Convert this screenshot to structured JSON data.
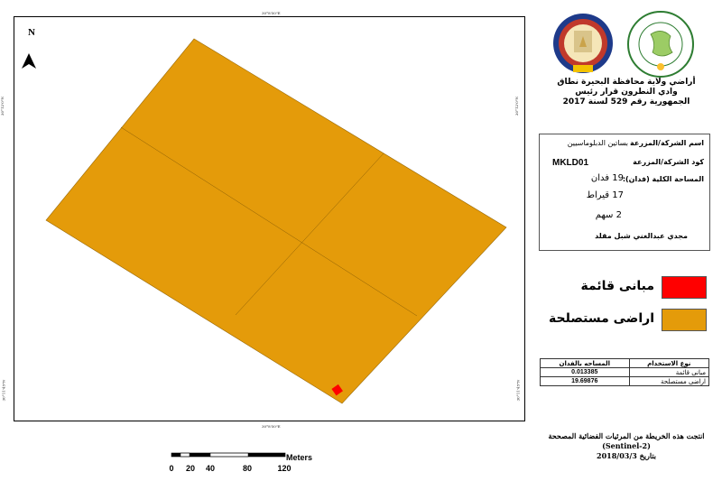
{
  "map": {
    "north_label": "N",
    "coords": {
      "top": "30°8'50\"E",
      "bottom": "30°8'50\"E",
      "left": "30°12'0\"N",
      "right": "30°12'0\"N",
      "left_lower": "30°11'45\"N",
      "right_lower": "30°11'45\"N"
    },
    "colors": {
      "reclaimed_land": "#E49B0A",
      "buildings": "#FF0000"
    }
  },
  "title": {
    "line1": "أراضي ولاية محافظة البحيرة نطاق",
    "line2": "وادي النطرون قرار رئيس",
    "line3": "الجمهورية رقم 529 لسنة 2017"
  },
  "info": {
    "company_label": "اسم الشركة/المزرعة",
    "company_value": "بساتين الدبلوماسيين",
    "code_label": "كود الشركة/المزرعة",
    "code_value": "MKLD01",
    "area_label": "المساحة الكلية (فدان):",
    "area_feddan": "19 فدان",
    "area_qirat": "17 قيراط",
    "area_sahm": "2 سهم",
    "owner": "مجدي عبدالغني شبل مقلد"
  },
  "legend": {
    "buildings": "مبانى قائمة",
    "reclaimed": "اراضى مستصلحة"
  },
  "stats": {
    "headers": {
      "area": "المساحه بالفدان",
      "use": "نوع الاستخدام"
    },
    "rows": [
      {
        "area": "0.013385",
        "use": "مبانى قائمة"
      },
      {
        "area": "19.69876",
        "use": "اراضى مستصلحة"
      }
    ]
  },
  "scale": {
    "unit": "Meters",
    "ticks": [
      "0",
      "20",
      "40",
      "80",
      "120"
    ]
  },
  "footer": {
    "line1": "انتجت هذه الخريطة من المرئيات الفضائية المصححة",
    "line2": "(Sentinel-2)",
    "line3": "بتاريخ 2018/03/3"
  }
}
